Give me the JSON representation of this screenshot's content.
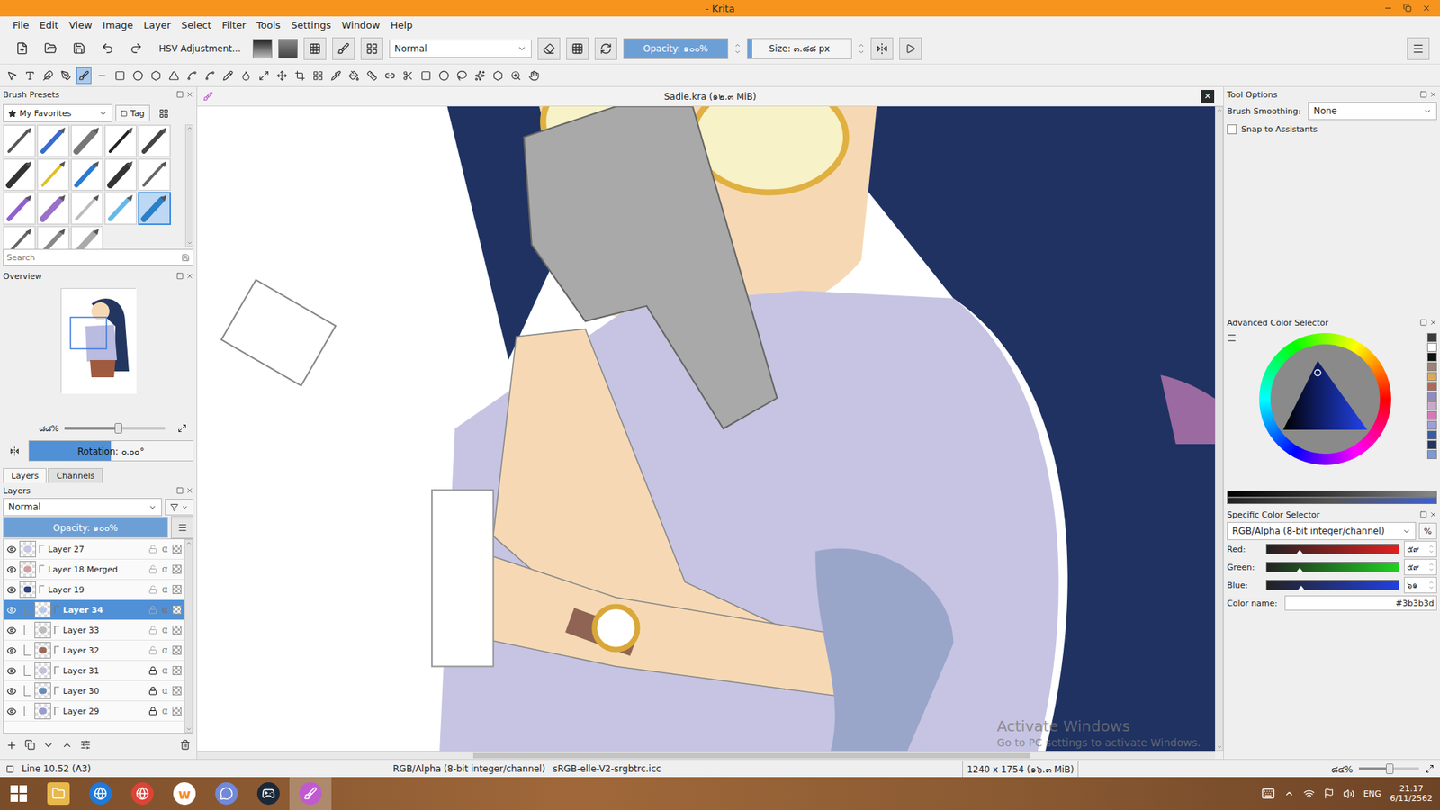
{
  "window": {
    "title": "- Krita"
  },
  "menu": [
    "File",
    "Edit",
    "View",
    "Image",
    "Layer",
    "Select",
    "Filter",
    "Tools",
    "Settings",
    "Window",
    "Help"
  ],
  "toolbar": {
    "preset": "HSV Adjustment...",
    "blend_mode": "Normal",
    "opacity": "Opacity: ๑๐๐%",
    "opacity_level": 1,
    "size": "Size: ๓.๘๘ px",
    "size_level": 0.04
  },
  "tools": [
    {
      "selected": false
    },
    {
      "selected": false
    },
    {
      "selected": false
    },
    {
      "selected": false
    },
    {
      "selected": true
    },
    {
      "selected": false
    },
    {
      "selected": false
    },
    {
      "selected": false
    },
    {
      "selected": false
    },
    {
      "selected": false
    },
    {
      "selected": false
    },
    {
      "selected": false
    },
    {
      "selected": false
    },
    {
      "selected": false
    },
    {
      "selected": false
    },
    {
      "selected": false
    },
    {
      "selected": false
    },
    {
      "selected": false
    },
    {
      "selected": false
    },
    {
      "selected": false
    },
    {
      "selected": false
    },
    {
      "selected": false
    },
    {
      "selected": false
    },
    {
      "selected": false
    },
    {
      "selected": false
    },
    {
      "selected": false
    },
    {
      "selected": false
    },
    {
      "selected": false
    },
    {
      "selected": false
    },
    {
      "selected": false
    }
  ],
  "brush_presets": {
    "title": "Brush Presets",
    "tag_filter": "My Favorites",
    "tag_button": "Tag",
    "search_placeholder": "Search",
    "presets": [
      {
        "selected": false
      },
      {
        "selected": false
      },
      {
        "selected": false
      },
      {
        "selected": false
      },
      {
        "selected": false
      },
      {
        "selected": false
      },
      {
        "selected": false
      },
      {
        "selected": false
      },
      {
        "selected": false
      },
      {
        "selected": false
      },
      {
        "selected": false
      },
      {
        "selected": false
      },
      {
        "selected": false
      },
      {
        "selected": false
      },
      {
        "selected": true
      },
      {
        "selected": false
      },
      {
        "selected": false
      },
      {
        "selected": false
      }
    ]
  },
  "overview": {
    "title": "Overview",
    "zoom": "๘๘%",
    "zoom_level": 0.5,
    "rotation": "Rotation: ๐.๐๐°",
    "rotation_level": 0.5
  },
  "layers": {
    "tabs": [
      {
        "label": "Layers",
        "selected": true
      },
      {
        "label": "Channels",
        "selected": false
      }
    ],
    "title": "Layers",
    "blend_mode": "Normal",
    "opacity": "Opacity: ๑๐๐%",
    "opacity_level": 1,
    "alpha_glyph": "α",
    "items": [
      {
        "name": "Layer 27",
        "selected": false,
        "locked": false,
        "child": false,
        "visible": true
      },
      {
        "name": "Layer 18 Merged",
        "selected": false,
        "locked": false,
        "child": false,
        "visible": true
      },
      {
        "name": "Layer 19",
        "selected": false,
        "locked": false,
        "child": false,
        "visible": true
      },
      {
        "name": "Layer 34",
        "selected": true,
        "locked": false,
        "child": true,
        "visible": true
      },
      {
        "name": "Layer 33",
        "selected": false,
        "locked": false,
        "child": true,
        "visible": true
      },
      {
        "name": "Layer 32",
        "selected": false,
        "locked": false,
        "child": true,
        "visible": true
      },
      {
        "name": "Layer 31",
        "selected": false,
        "locked": true,
        "child": true,
        "visible": true
      },
      {
        "name": "Layer 30",
        "selected": false,
        "locked": true,
        "child": true,
        "visible": true
      },
      {
        "name": "Layer 29",
        "selected": false,
        "locked": true,
        "child": true,
        "visible": true
      }
    ]
  },
  "document": {
    "title": "Sadie.kra (๑๒.๓ MiB)",
    "close": "✕"
  },
  "tool_options": {
    "title": "Tool Options",
    "smoothing_label": "Brush Smoothing:",
    "smoothing_value": "None",
    "snap_label": "Snap to Assistants",
    "snap_checked": false
  },
  "advanced_color": {
    "title": "Advanced Color Selector",
    "recent_colors": [
      "#3b3b3d",
      "#ffffff",
      "#111111",
      "#9c8376",
      "#dba85a",
      "#b0685a",
      "#8f8bbd",
      "#c9a9cb",
      "#d47ab8",
      "#9d9fd6",
      "#3b5b9c",
      "#23345e",
      "#7a9ad8"
    ]
  },
  "specific_color": {
    "title": "Specific Color Selector",
    "model": "RGB/Alpha (8-bit integer/channel)",
    "percent_button": "%",
    "channels": [
      {
        "name": "Red:",
        "value": "๕๙",
        "level": 0.23,
        "color": "#e02020"
      },
      {
        "name": "Green:",
        "value": "๕๙",
        "level": 0.23,
        "color": "#20d020"
      },
      {
        "name": "Blue:",
        "value": "๖๑",
        "level": 0.24,
        "color": "#2040e0"
      }
    ],
    "color_name_label": "Color name:",
    "color_name": "#3b3b3d"
  },
  "status_bar": {
    "brush": "Line 10.52 (A3)",
    "color_model": "RGB/Alpha (8-bit integer/channel)",
    "profile": "sRGB-elle-V2-srgbtrc.icc",
    "image_size": "1240 x 1754 (๑๖.๓ MiB)",
    "zoom": "๘๔%",
    "zoom_level": 0.45
  },
  "watermark": {
    "title": "Activate Windows",
    "subtitle": "Go to PC settings to activate Windows."
  },
  "taskbar": {
    "apps": [
      {
        "app": "explorer",
        "glyph": "",
        "active": false
      },
      {
        "app": "internet-explorer",
        "glyph": "",
        "active": false
      },
      {
        "app": "chrome",
        "glyph": "",
        "active": false
      },
      {
        "app": "wattpad",
        "glyph": "w",
        "active": false
      },
      {
        "app": "discord",
        "glyph": "",
        "active": false
      },
      {
        "app": "steam",
        "glyph": "",
        "active": false
      },
      {
        "app": "krita",
        "glyph": "",
        "active": true
      }
    ],
    "language": "ENG",
    "time": "21:17",
    "date": "6/11/2562"
  }
}
